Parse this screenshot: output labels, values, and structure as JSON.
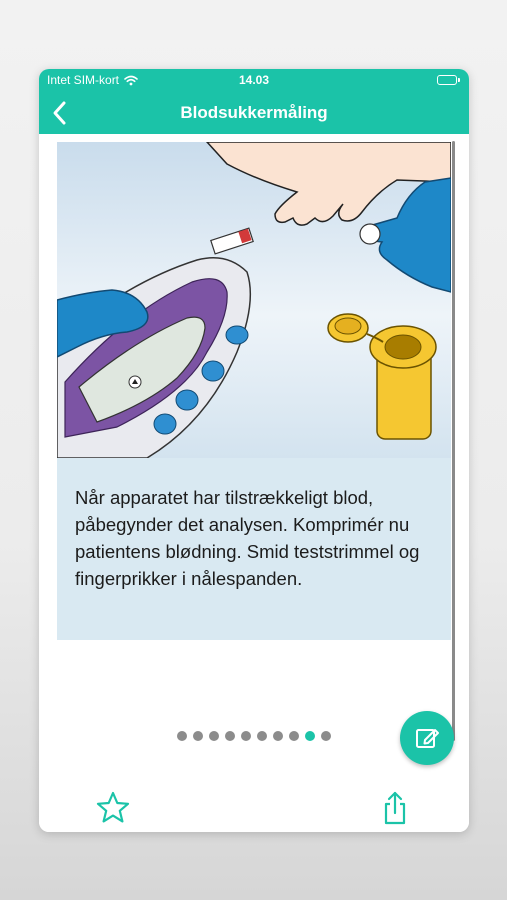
{
  "status_bar": {
    "carrier": "Intet SIM-kort",
    "time": "14.03"
  },
  "nav": {
    "title": "Blodsukkermåling"
  },
  "step": {
    "text": "Når apparatet har tilstrækkeligt blod, påbegynder det analysen. Komprimér nu patientens blødning. Smid teststrimmel og fingerprikker i nålespanden."
  },
  "pagination": {
    "total": 10,
    "current": 9
  },
  "colors": {
    "accent": "#1bc3a8",
    "panel": "#d9e9f2",
    "dot_inactive": "#8c8c8c"
  },
  "icons": {
    "back": "chevron-left-icon",
    "edit": "edit-note-icon",
    "favorite": "star-icon",
    "share": "share-icon",
    "wifi": "wifi-icon",
    "battery": "battery-icon"
  }
}
